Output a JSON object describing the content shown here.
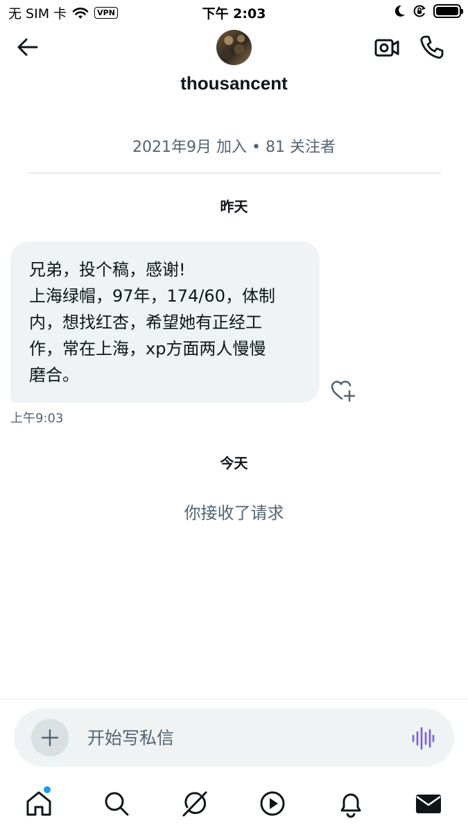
{
  "status_bar": {
    "carrier": "无 SIM 卡",
    "vpn": "VPN",
    "time": "下午 2:03"
  },
  "header": {
    "username": "thousancent",
    "meta": "2021年9月 加入 • 81 关注者"
  },
  "conversation": {
    "yesterday_label": "昨天",
    "message": {
      "lines": [
        "兄弟，投个稿，感谢!",
        "上海绿帽，97年，174/60，体制",
        "内，想找红杏，希望她有正经工",
        "作，常在上海，xp方面两人慢慢",
        "磨合。"
      ],
      "time": "上午9:03"
    },
    "today_label": "今天",
    "system_note": "你接收了请求"
  },
  "composer": {
    "placeholder": "开始写私信"
  },
  "colors": {
    "accent": "#1d9bf0",
    "voice": "#7856ff",
    "secondary_text": "#536471",
    "bubble": "#eff3f4"
  },
  "icons": {
    "back": "arrow-left-icon",
    "video": "video-camera-icon",
    "call": "phone-icon",
    "like": "heart-plus-icon",
    "add": "plus-icon",
    "voice": "voice-wave-icon",
    "nav": [
      "home-icon",
      "search-icon",
      "grok-icon",
      "play-icon",
      "bell-icon",
      "mail-icon"
    ]
  }
}
